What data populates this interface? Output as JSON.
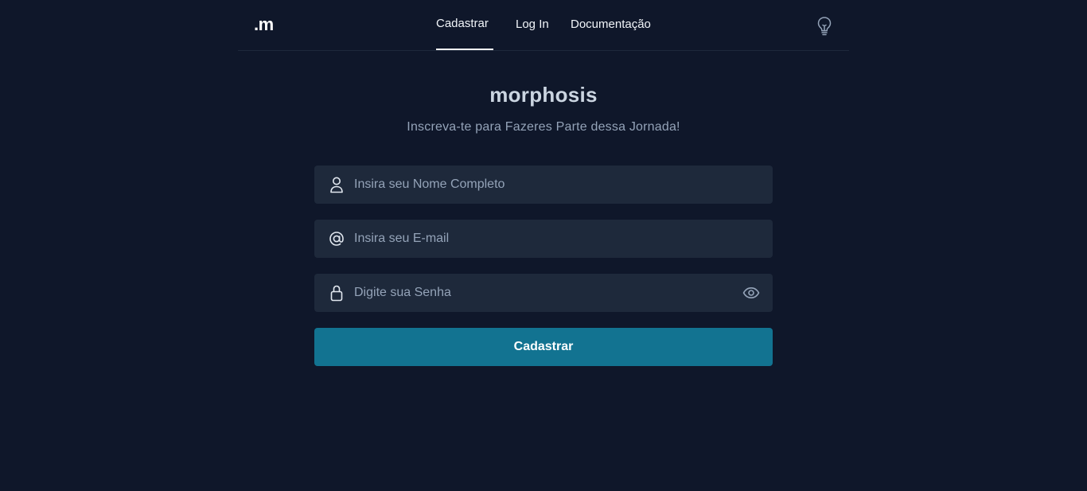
{
  "header": {
    "logo": ".m",
    "nav": [
      {
        "label": "Cadastrar",
        "active": true
      },
      {
        "label": "Log In",
        "active": false
      },
      {
        "label": "Documentação",
        "active": false
      }
    ],
    "theme_icon": "lightbulb-icon"
  },
  "main": {
    "brand": "morphosis",
    "tagline": "Inscreva-te para Fazeres Parte dessa Jornada!"
  },
  "form": {
    "name": {
      "placeholder": "Insira seu Nome Completo",
      "value": "",
      "icon": "user-icon"
    },
    "email": {
      "placeholder": "Insira seu E-mail",
      "value": "",
      "icon": "at-sign-icon"
    },
    "password": {
      "placeholder": "Digite sua Senha",
      "value": "",
      "icon": "lock-icon",
      "toggle_icon": "eye-icon"
    },
    "submit_label": "Cadastrar"
  },
  "colors": {
    "background": "#0f172a",
    "field_background": "#1e293b",
    "accent": "#127391",
    "text_muted": "#94a3b8"
  }
}
